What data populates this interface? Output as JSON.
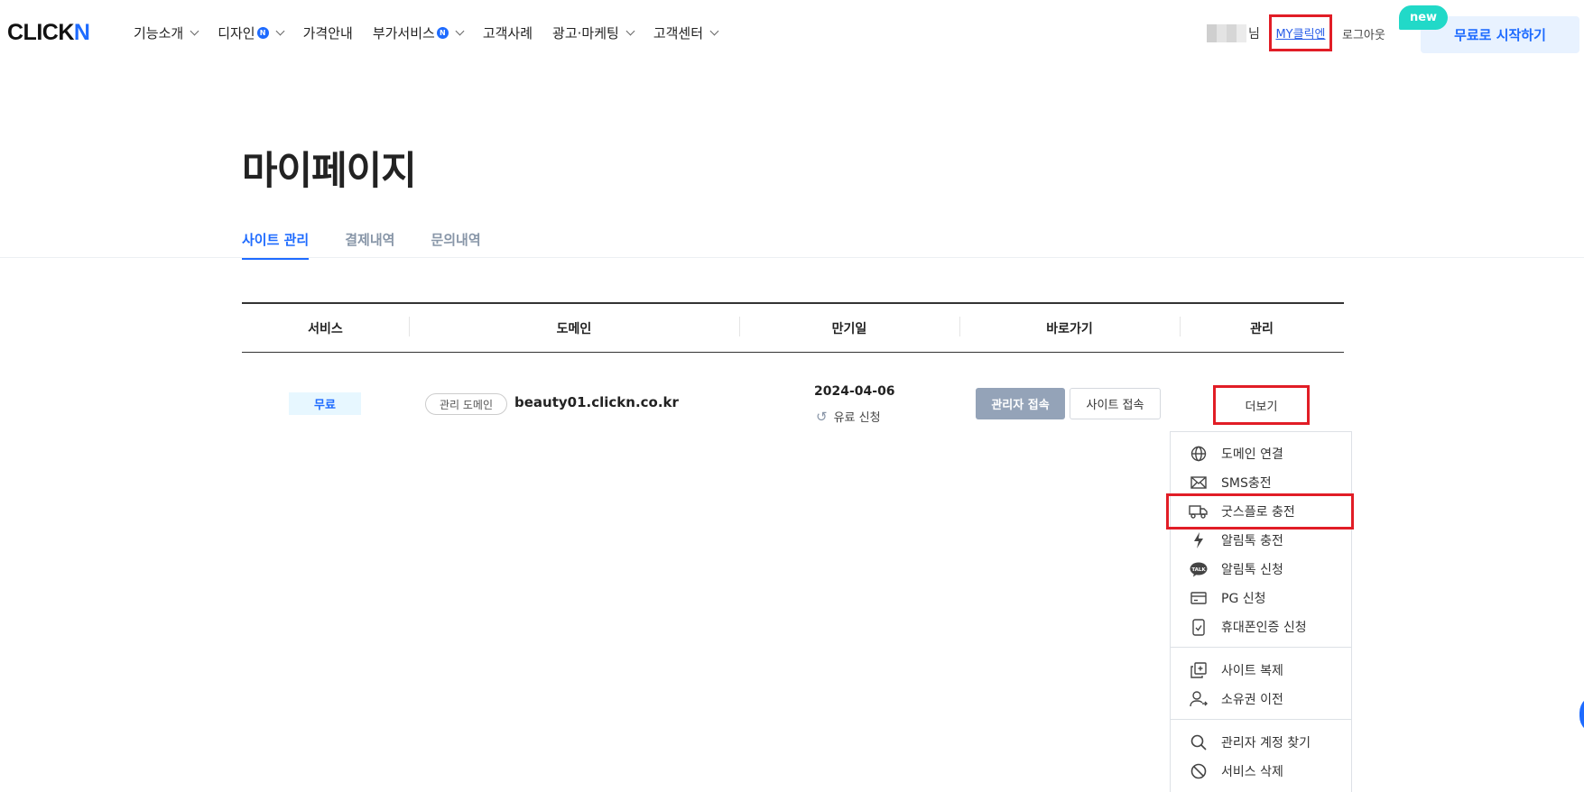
{
  "header": {
    "logo_text": "CLICK",
    "logo_n": "N",
    "nav": [
      {
        "label": "기능소개",
        "badge": "",
        "chevron": true
      },
      {
        "label": "디자인",
        "badge": "N",
        "chevron": true
      },
      {
        "label": "가격안내",
        "badge": "",
        "chevron": false
      },
      {
        "label": "부가서비스",
        "badge": "N",
        "chevron": true
      },
      {
        "label": "고객사례",
        "badge": "",
        "chevron": false
      },
      {
        "label": "광고·마케팅",
        "badge": "",
        "chevron": true
      },
      {
        "label": "고객센터",
        "badge": "",
        "chevron": true
      }
    ],
    "user_suffix": "님",
    "my_link": "MY클릭엔",
    "logout": "로그아웃",
    "new_badge": "new",
    "start_button": "무료로 시작하기"
  },
  "page": {
    "title": "마이페이지",
    "tabs": [
      "사이트 관리",
      "결제내역",
      "문의내역"
    ],
    "active_tab": 0
  },
  "table": {
    "headers": [
      "서비스",
      "도메인",
      "만기일",
      "바로가기",
      "관리"
    ],
    "row": {
      "service": "무료",
      "domain_tag": "관리 도메인",
      "domain": "beauty01.clickn.co.kr",
      "expiry": "2024-04-06",
      "renew": "유료 신청",
      "admin_button": "관리자 접속",
      "site_button": "사이트 접속",
      "more_button": "더보기"
    }
  },
  "menu": {
    "groups": [
      [
        {
          "icon": "globe-icon",
          "label": "도메인 연결"
        },
        {
          "icon": "mail-icon",
          "label": "SMS충전"
        },
        {
          "icon": "truck-icon",
          "label": "굿스플로 충전"
        },
        {
          "icon": "bolt-icon",
          "label": "알림톡 충전"
        },
        {
          "icon": "talk-icon",
          "label": "알림톡 신청"
        },
        {
          "icon": "card-icon",
          "label": "PG 신청"
        },
        {
          "icon": "phone-check-icon",
          "label": "휴대폰인증 신청"
        }
      ],
      [
        {
          "icon": "copy-icon",
          "label": "사이트 복제"
        },
        {
          "icon": "user-transfer-icon",
          "label": "소유권 이전"
        }
      ],
      [
        {
          "icon": "search-icon",
          "label": "관리자 계정 찾기"
        },
        {
          "icon": "ban-icon",
          "label": "서비스 삭제"
        }
      ]
    ]
  },
  "colors": {
    "brand": "#1e6bff",
    "highlight": "#e11d26",
    "new_badge": "#21d9c8",
    "admin_button": "#94a3b8"
  }
}
